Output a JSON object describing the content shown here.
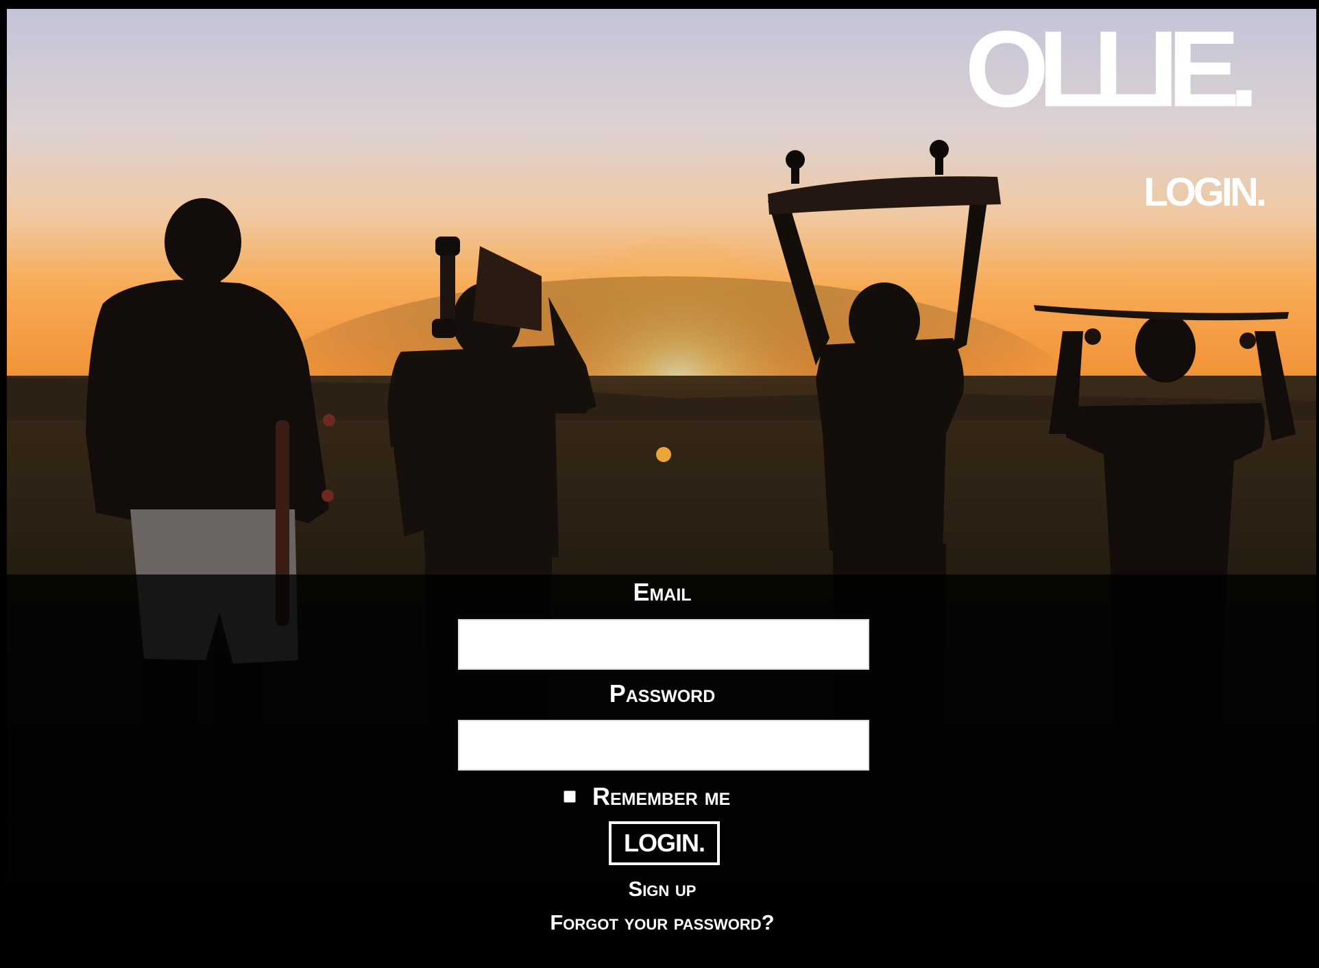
{
  "brand": {
    "logo_text": "OLLIE.",
    "page_heading": "LOGIN."
  },
  "form": {
    "email_label": "Email",
    "email_value": "",
    "password_label": "Password",
    "password_value": "",
    "remember_label": "Remember me",
    "remember_checked": false,
    "submit_label": "LOGIN."
  },
  "links": {
    "sign_up": "Sign up",
    "forgot_password": "Forgot your password?"
  },
  "colors": {
    "text": "#ffffff",
    "panel": "#000000",
    "sky_top": "#c7c8dc",
    "sky_horizon": "#f5a04a"
  },
  "background": {
    "image": "sunset-skaters-photo"
  }
}
